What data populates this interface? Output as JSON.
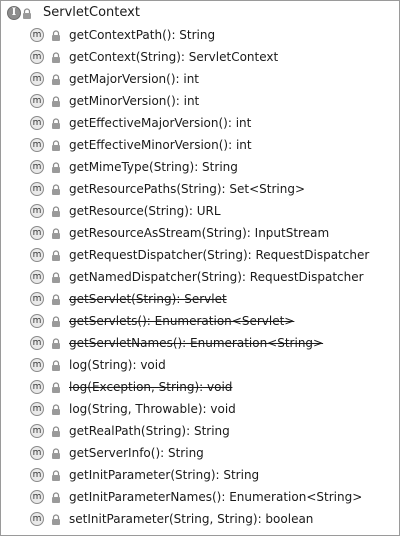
{
  "header": {
    "type_badge": "I",
    "title": "ServletContext"
  },
  "method_badge": "m",
  "icons": {
    "type": "interface-icon",
    "method": "method-icon",
    "visibility": "lock-icon"
  },
  "members": [
    {
      "label": "getContextPath(): String",
      "deprecated": false
    },
    {
      "label": "getContext(String): ServletContext",
      "deprecated": false
    },
    {
      "label": "getMajorVersion(): int",
      "deprecated": false
    },
    {
      "label": "getMinorVersion(): int",
      "deprecated": false
    },
    {
      "label": "getEffectiveMajorVersion(): int",
      "deprecated": false
    },
    {
      "label": "getEffectiveMinorVersion(): int",
      "deprecated": false
    },
    {
      "label": "getMimeType(String): String",
      "deprecated": false
    },
    {
      "label": "getResourcePaths(String): Set<String>",
      "deprecated": false
    },
    {
      "label": "getResource(String): URL",
      "deprecated": false
    },
    {
      "label": "getResourceAsStream(String): InputStream",
      "deprecated": false
    },
    {
      "label": "getRequestDispatcher(String): RequestDispatcher",
      "deprecated": false
    },
    {
      "label": "getNamedDispatcher(String): RequestDispatcher",
      "deprecated": false
    },
    {
      "label": "getServlet(String): Servlet",
      "deprecated": true
    },
    {
      "label": "getServlets(): Enumeration<Servlet>",
      "deprecated": true
    },
    {
      "label": "getServletNames(): Enumeration<String>",
      "deprecated": true
    },
    {
      "label": "log(String): void",
      "deprecated": false
    },
    {
      "label": "log(Exception, String): void",
      "deprecated": true
    },
    {
      "label": "log(String, Throwable): void",
      "deprecated": false
    },
    {
      "label": "getRealPath(String): String",
      "deprecated": false
    },
    {
      "label": "getServerInfo(): String",
      "deprecated": false
    },
    {
      "label": "getInitParameter(String): String",
      "deprecated": false
    },
    {
      "label": "getInitParameterNames(): Enumeration<String>",
      "deprecated": false
    },
    {
      "label": "setInitParameter(String, String): boolean",
      "deprecated": false
    }
  ]
}
